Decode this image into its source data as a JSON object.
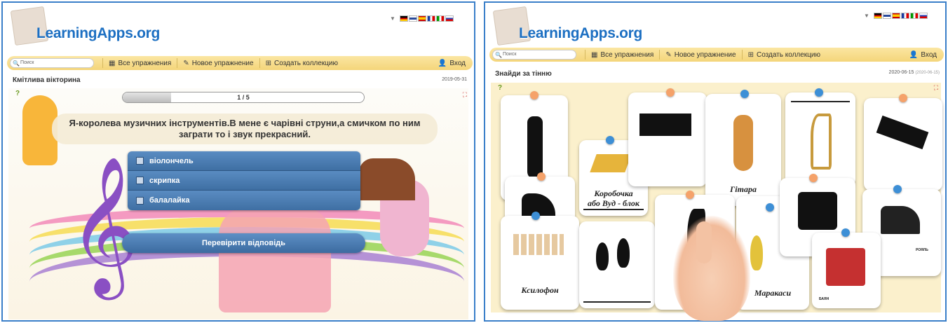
{
  "site": {
    "logo_text": "LearningApps.org",
    "search_placeholder": "Поиск",
    "nav": [
      {
        "icon": "grid-icon",
        "label": "Все упражнения"
      },
      {
        "icon": "pencil-icon",
        "label": "Новое упражнение"
      },
      {
        "icon": "collection-icon",
        "label": "Создать коллекцию"
      }
    ],
    "login_label": "Вход",
    "flags": [
      "de",
      "gb",
      "es",
      "fr",
      "it",
      "ru"
    ]
  },
  "left": {
    "title": "Кмітлива вікторина",
    "date": "2019-05-31",
    "progress": {
      "text": "1 / 5",
      "fraction": 0.2
    },
    "question": "Я-королева музичних інструментів.В мене є чарівні струни,а смичком по ним заграти то і звук прекрасний.",
    "answers": [
      "віолончель",
      "скрипка",
      "балалайка"
    ],
    "check_label": "Перевірити відповідь"
  },
  "right": {
    "title": "Знайди за тінню",
    "date": "2020-06-15",
    "date_small": "(2020-06-15)",
    "captions": {
      "guitar": "Гітара",
      "woodblock_1": "Коробочка",
      "woodblock_2": "або Вуд - блок",
      "xylophone": "Ксилофон",
      "maracas": "Маракаси",
      "piano_tag": "РОЯЛЬ",
      "accordion_tag": "БАЯН"
    }
  },
  "colors": {
    "accent": "#3a7fc9",
    "navbar": "#f6db85",
    "answer_blue": "#4a7db3",
    "pin_orange": "#f5a26a",
    "pin_blue": "#3d8fd6"
  }
}
